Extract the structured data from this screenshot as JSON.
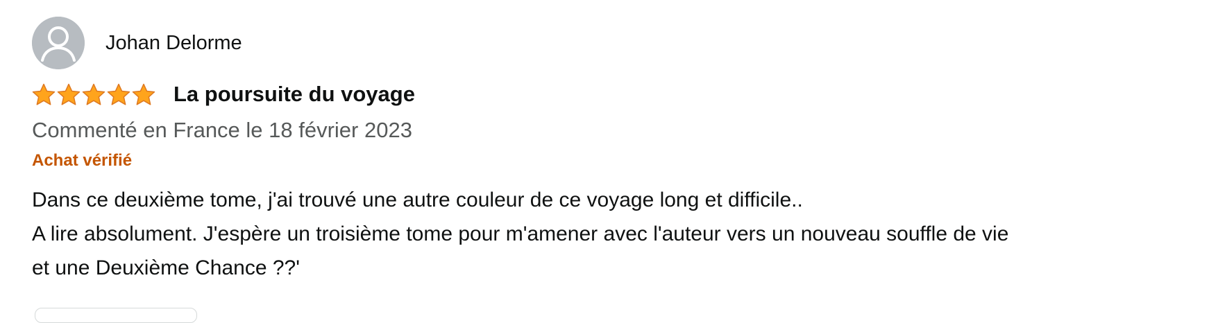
{
  "review": {
    "author": "Johan Delorme",
    "rating": 5,
    "rating_max": 5,
    "title": "La poursuite du voyage",
    "date": "Commenté en France le 18 février 2023",
    "verified_label": "Achat vérifié",
    "body_lines": [
      "Dans ce deuxième tome, j'ai trouvé une autre couleur de ce voyage long et difficile..",
      "A lire absolument. J'espère un troisième tome pour m'amener avec l'auteur vers un nouveau souffle de vie",
      "et une Deuxième Chance ??'"
    ]
  },
  "icons": {
    "avatar": "default-user-avatar-icon",
    "star": "star-filled-icon"
  },
  "colors": {
    "star_fill": "#ffa41c",
    "star_stroke": "#de7921",
    "verified": "#c45500",
    "date": "#565959",
    "text": "#0f1111",
    "avatar_bg": "#b7bcc1"
  }
}
